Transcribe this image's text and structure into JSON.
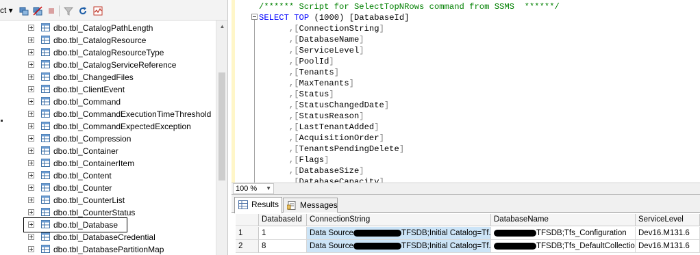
{
  "object_explorer": {
    "connect_label": "ct ▾",
    "toolbar_icons": [
      "connect-object-explorer-icon",
      "disconnect-icon",
      "stop-icon",
      "filter-icon",
      "refresh-icon",
      "activity-monitor-icon"
    ],
    "items": [
      {
        "label": "dbo.tbl_CatalogPathLength"
      },
      {
        "label": "dbo.tbl_CatalogResource"
      },
      {
        "label": "dbo.tbl_CatalogResourceType"
      },
      {
        "label": "dbo.tbl_CatalogServiceReference"
      },
      {
        "label": "dbo.tbl_ChangedFiles"
      },
      {
        "label": "dbo.tbl_ClientEvent"
      },
      {
        "label": "dbo.tbl_Command"
      },
      {
        "label": "dbo.tbl_CommandExecutionTimeThreshold"
      },
      {
        "label": "dbo.tbl_CommandExpectedException"
      },
      {
        "label": "dbo.tbl_Compression"
      },
      {
        "label": "dbo.tbl_Container"
      },
      {
        "label": "dbo.tbl_ContainerItem"
      },
      {
        "label": "dbo.tbl_Content"
      },
      {
        "label": "dbo.tbl_Counter"
      },
      {
        "label": "dbo.tbl_CounterList"
      },
      {
        "label": "dbo.tbl_CounterStatus"
      },
      {
        "label": "dbo.tbl_Database",
        "selected": true
      },
      {
        "label": "dbo.tbl_DatabaseCredential"
      },
      {
        "label": "dbo.tbl_DatabasePartitionMap"
      }
    ]
  },
  "editor": {
    "comment": "/****** Script for SelectTopNRows command from SSMS  ******/",
    "select_kw": "SELECT",
    "top_kw": "TOP",
    "top_value": "(1000)",
    "first_column": "[DatabaseId]",
    "columns": [
      ",[ConnectionString]",
      ",[DatabaseName]",
      ",[ServiceLevel]",
      ",[PoolId]",
      ",[Tenants]",
      ",[MaxTenants]",
      ",[Status]",
      ",[StatusChangedDate]",
      ",[StatusReason]",
      ",[LastTenantAdded]",
      ",[AcquisitionOrder]",
      ",[TenantsPendingDelete]",
      ",[Flags]",
      ",[DatabaseSize]",
      ",[DatabaseCapacity]"
    ]
  },
  "zoom": {
    "value": "100 %"
  },
  "results": {
    "tabs": [
      {
        "label": "Results",
        "icon": "grid-results-icon",
        "active": true
      },
      {
        "label": "Messages",
        "icon": "messages-icon",
        "active": false
      }
    ],
    "columns": [
      "DatabaseId",
      "ConnectionString",
      "DatabaseName",
      "ServiceLevel"
    ],
    "rows": [
      {
        "num": "1",
        "DatabaseId": "1",
        "cs_prefix": "Data Source",
        "cs_suffix": "TFSDB;Initial Catalog=Tf...",
        "dbname_suffix": "TFSDB;Tfs_Configuration",
        "ServiceLevel": "Dev16.M131.6"
      },
      {
        "num": "2",
        "DatabaseId": "8",
        "cs_prefix": "Data Source",
        "cs_suffix": "TFSDB;Initial Catalog=Tf...",
        "dbname_suffix": "TFSDB;Tfs_DefaultCollection",
        "ServiceLevel": "Dev16.M131.6"
      }
    ]
  },
  "colors": {
    "comment": "#008000",
    "keyword": "#0000ff",
    "selection_highlight": "#cce4f7"
  }
}
